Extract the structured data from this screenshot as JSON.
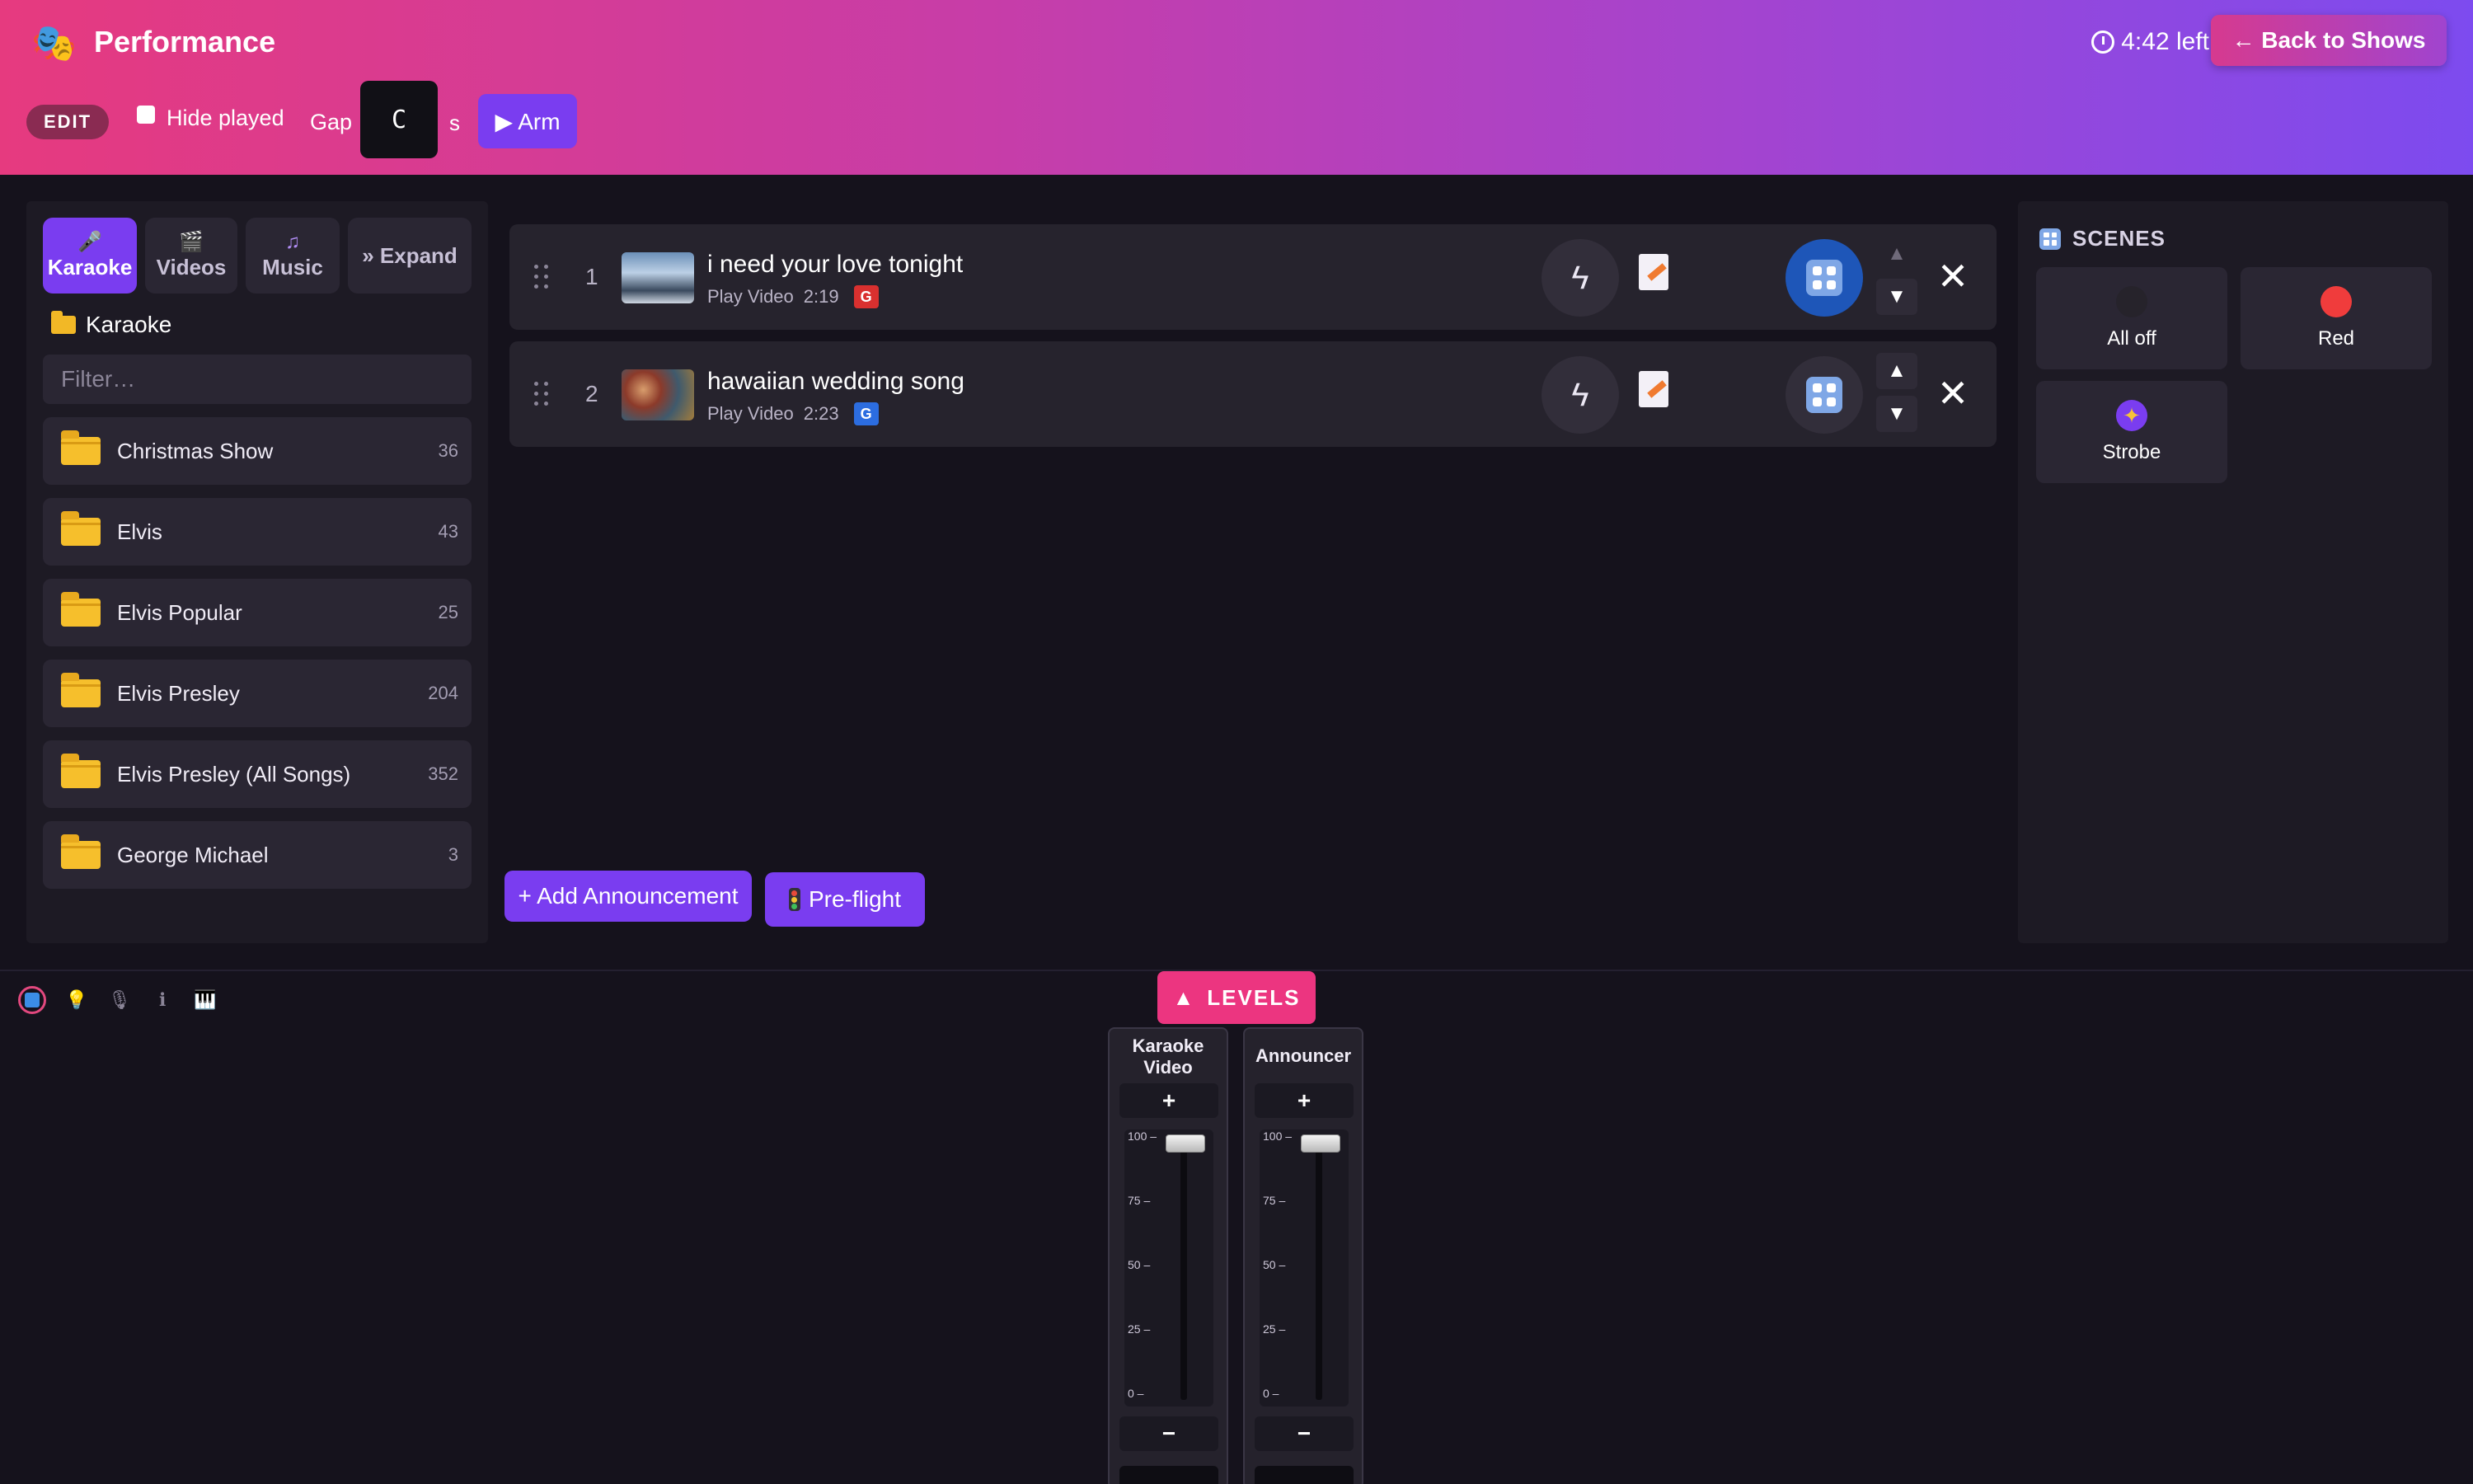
{
  "header": {
    "title": "Performance",
    "timer_text": "4:42 left",
    "back_label": "← Back to Shows",
    "edit_label": "EDIT",
    "hide_played_label": "Hide played",
    "gap_label": "Gap",
    "gap_value": "C",
    "gap_unit": "s",
    "arm_label": "▶ Arm"
  },
  "library": {
    "tabs": [
      {
        "label": "Karaoke",
        "icon": "microphone-icon",
        "active": true
      },
      {
        "label": "Videos",
        "icon": "clapperboard-icon",
        "active": false
      },
      {
        "label": "Music",
        "icon": "music-note-icon",
        "active": false
      }
    ],
    "expand_label": "» Expand",
    "current_folder": "Karaoke",
    "filter_placeholder": "Filter…",
    "folders": [
      {
        "name": "Christmas Show",
        "count": "36"
      },
      {
        "name": "Elvis",
        "count": "43"
      },
      {
        "name": "Elvis Popular",
        "count": "25"
      },
      {
        "name": "Elvis Presley",
        "count": "204"
      },
      {
        "name": "Elvis Presley (All Songs)",
        "count": "352"
      },
      {
        "name": "George Michael",
        "count": "3"
      }
    ]
  },
  "queue": {
    "items": [
      {
        "num": "1",
        "title": "i need your love tonight",
        "action": "Play Video",
        "duration": "2:19",
        "rating": "G",
        "rating_color": "#d9302f",
        "scene_active": true
      },
      {
        "num": "2",
        "title": "hawaiian wedding song",
        "action": "Play Video",
        "duration": "2:23",
        "rating": "G",
        "rating_color": "#2c6de0",
        "scene_active": false
      }
    ],
    "add_announcement_label": "+ Add Announcement",
    "preflight_label": "Pre-flight"
  },
  "scenes": {
    "header": "SCENES",
    "items": [
      {
        "label": "All off",
        "color": "#26232b"
      },
      {
        "label": "Red",
        "color": "#f03c3c"
      },
      {
        "label": "Strobe",
        "icon": "sparkle-icon"
      }
    ]
  },
  "levels": {
    "toggle_label": "LEVELS",
    "strips": [
      {
        "name": "Karaoke Video",
        "plus": "+",
        "minus": "−",
        "level_percent": 100
      },
      {
        "name": "Announcer",
        "plus": "+",
        "minus": "−",
        "level_percent": 100
      }
    ],
    "ticks": [
      "100",
      "75",
      "50",
      "25",
      "0"
    ]
  },
  "bottom_icons": [
    "levels-icon",
    "light-bulb-icon",
    "microphone-icon",
    "info-icon",
    "piano-icon"
  ],
  "colors": {
    "accent": "#7a3df0",
    "levels_accent": "#ec3580",
    "panel_bg": "#1d1a24"
  }
}
